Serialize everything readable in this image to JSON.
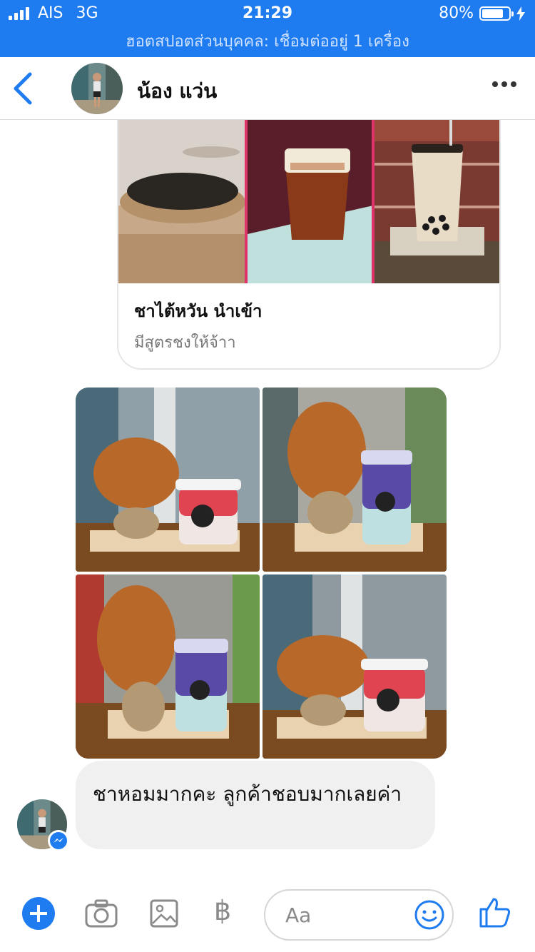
{
  "status_bar": {
    "carrier": "AIS",
    "network": "3G",
    "time": "21:29",
    "battery": "80%",
    "battery_level": 0.8
  },
  "hotspot_text": "ฮอตสปอตส่วนบุคคล: เชื่อมต่ออยู่ 1 เครื่อง",
  "header": {
    "contact_name": "น้อง แว่น"
  },
  "shared_card": {
    "title": "ชาไต้หวัน นำเข้า",
    "subtitle": "มีสูตรชงให้จ้าา"
  },
  "message": {
    "text": "ชาหอมมากคะ ลูกค้าชอบมากเลยค่า"
  },
  "composer": {
    "placeholder": "Aa",
    "baht_symbol": "฿"
  },
  "colors": {
    "accent": "#1f7cf0",
    "bubble": "#f0f0f0"
  }
}
